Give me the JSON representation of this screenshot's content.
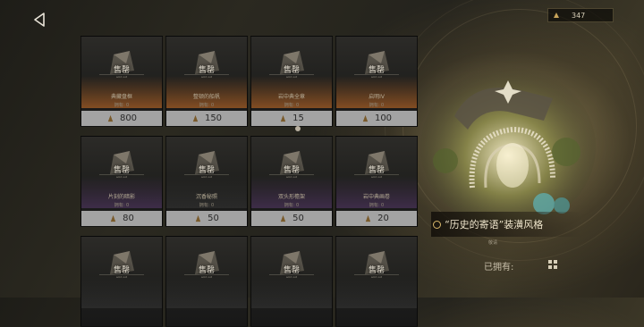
{
  "header": {
    "currency_value": "347"
  },
  "colors": {
    "accent_gold": "#d9b86a",
    "price_bar": "#a3a3a3"
  },
  "items": [
    {
      "sold_label": "售罄",
      "sold_sub": "sold out",
      "name": "典藏盘框",
      "owned": "拥有: 0",
      "price": "800",
      "tint": "orange"
    },
    {
      "sold_label": "售罄",
      "sold_sub": "sold out",
      "name": "整顿的船帆",
      "owned": "拥有: 0",
      "price": "150",
      "tint": "orange"
    },
    {
      "sold_label": "售罄",
      "sold_sub": "sold out",
      "name": "岩中典全章",
      "owned": "拥有: 0",
      "price": "15",
      "tint": "orange"
    },
    {
      "sold_label": "售罄",
      "sold_sub": "sold out",
      "name": "启明IV",
      "owned": "拥有: 0",
      "price": "100",
      "tint": "orange"
    },
    {
      "sold_label": "售罄",
      "sold_sub": "sold out",
      "name": "片刻的暗影",
      "owned": "拥有: 0",
      "price": "80",
      "tint": "purple"
    },
    {
      "sold_label": "售罄",
      "sold_sub": "sold out",
      "name": "沉香秘照",
      "owned": "拥有: 0",
      "price": "50",
      "tint": "neutral"
    },
    {
      "sold_label": "售罄",
      "sold_sub": "sold out",
      "name": "双头形檐架",
      "owned": "拥有: 0",
      "price": "50",
      "tint": "purple"
    },
    {
      "sold_label": "售罄",
      "sold_sub": "sold out",
      "name": "岩中典画卷",
      "owned": "拥有: 0",
      "price": "20",
      "tint": "purple"
    },
    {
      "sold_label": "售罄",
      "sold_sub": "sold out",
      "name": "",
      "owned": "",
      "price": "",
      "tint": "neutral"
    },
    {
      "sold_label": "售罄",
      "sold_sub": "sold out",
      "name": "",
      "owned": "",
      "price": "",
      "tint": "neutral"
    },
    {
      "sold_label": "售罄",
      "sold_sub": "sold out",
      "name": "",
      "owned": "",
      "price": "",
      "tint": "neutral"
    },
    {
      "sold_label": "售罄",
      "sold_sub": "sold out",
      "name": "",
      "owned": "",
      "price": "",
      "tint": "neutral"
    }
  ],
  "preview": {
    "title": "“历史的寄语”装潢风格",
    "subtitle": "敬请",
    "owned_label": "已拥有:"
  }
}
